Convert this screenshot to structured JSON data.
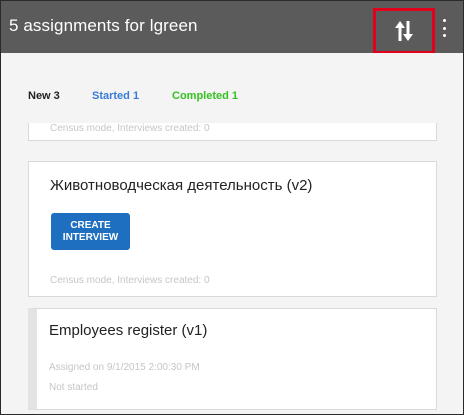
{
  "header": {
    "title": "5 assignments for lgreen",
    "sync_icon": "sync-arrows-icon",
    "more_icon": "more-vertical-icon",
    "highlight_color": "#e3001b"
  },
  "tabs": [
    {
      "label": "New 3",
      "color": "#222222"
    },
    {
      "label": "Started 1",
      "color": "#3a7bd5"
    },
    {
      "label": "Completed 1",
      "color": "#35c023"
    }
  ],
  "cards": [
    {
      "subtitle": "Census mode, Interviews created: 0"
    },
    {
      "title": "Животноводческая деятельность (v2)",
      "button_label": "CREATE INTERVIEW",
      "subtitle": "Census mode, Interviews created: 0"
    },
    {
      "title": "Employees register (v1)",
      "assigned": "Assigned on 9/1/2015 2:00:30 PM",
      "status": "Not started"
    }
  ]
}
